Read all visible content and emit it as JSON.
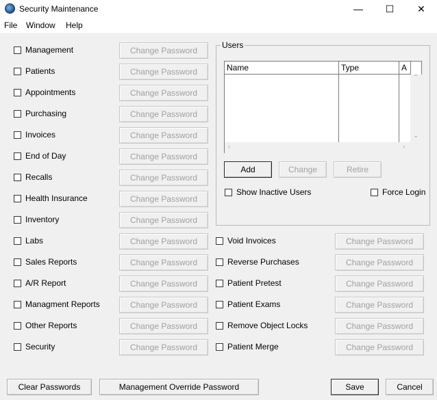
{
  "window": {
    "title": "Security Maintenance",
    "minimize": "—",
    "maximize": "☐",
    "close": "✕"
  },
  "menu": [
    "File",
    "Window",
    "Help"
  ],
  "change_password_label": "Change Password",
  "left_modules": [
    "Management",
    "Patients",
    "Appointments",
    "Purchasing",
    "Invoices",
    "End of Day",
    "Recalls",
    "Health Insurance",
    "Inventory",
    "Labs",
    "Sales Reports",
    "A/R Report",
    "Managment Reports",
    "Other Reports",
    "Security"
  ],
  "right_modules": [
    "Void Invoices",
    "Reverse Purchases",
    "Patient Pretest",
    "Patient Exams",
    "Remove Object Locks",
    "Patient Merge"
  ],
  "users": {
    "group_label": "Users",
    "columns": [
      "Name",
      "Type",
      "A"
    ],
    "rows": [],
    "add": "Add",
    "change": "Change",
    "retire": "Retire",
    "show_inactive": "Show Inactive Users",
    "force_login": "Force Login"
  },
  "footer": {
    "clear": "Clear Passwords",
    "override": "Management Override Password",
    "save": "Save",
    "cancel": "Cancel"
  }
}
